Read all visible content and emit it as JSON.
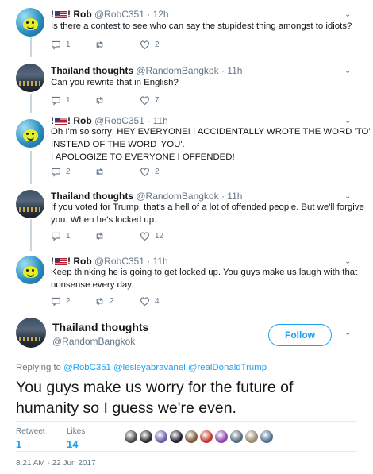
{
  "thread": [
    {
      "name": "! Rob",
      "name_prefix": "!",
      "handle": "@RobC351",
      "time": "12h",
      "text_lines": [
        "Is there a contest to see who can say the stupidest thing amongst to idiots?"
      ],
      "reply_count": "1",
      "retweet_count": "",
      "like_count": "2"
    },
    {
      "name": "Thailand thoughts",
      "handle": "@RandomBangkok",
      "time": "11h",
      "text_lines": [
        "Can you rewrite that in English?"
      ],
      "reply_count": "1",
      "retweet_count": "",
      "like_count": "7"
    },
    {
      "name": "! Rob",
      "name_prefix": "!",
      "handle": "@RobC351",
      "time": "11h",
      "text_lines": [
        "Oh I'm so sorry! HEY EVERYONE! I ACCIDENTALLY WROTE THE WORD 'TO'",
        "INSTEAD OF THE WORD 'YOU'.",
        "I APOLOGIZE TO EVERYONE I OFFENDED!"
      ],
      "reply_count": "2",
      "retweet_count": "",
      "like_count": "2"
    },
    {
      "name": "Thailand thoughts",
      "handle": "@RandomBangkok",
      "time": "11h",
      "text_lines": [
        "If you voted for Trump, that's a hell of a lot of offended people. But we'll forgive",
        "you. When he's locked up."
      ],
      "reply_count": "1",
      "retweet_count": "",
      "like_count": "12"
    },
    {
      "name": "! Rob",
      "name_prefix": "!",
      "handle": "@RobC351",
      "time": "11h",
      "text_lines": [
        "Keep thinking he is going to get locked up. You guys make us laugh with that",
        "nonsense every day."
      ],
      "reply_count": "2",
      "retweet_count": "2",
      "like_count": "4"
    }
  ],
  "main_tweet": {
    "name": "Thailand thoughts",
    "handle": "@RandomBangkok",
    "follow_label": "Follow",
    "replying_prefix": "Replying to",
    "replying_to": "@RobC351 @lesleyabravanel @realDonaldTrump",
    "text_lines": [
      "You guys make us worry for the future of",
      "humanity so I guess we're even."
    ],
    "retweets_label": "Retweet",
    "retweets_count": "1",
    "likes_label": "Likes",
    "likes_count": "14",
    "timestamp": "8:21 AM - 22 Jun 2017"
  },
  "icons": {
    "reply": "reply-icon",
    "retweet": "retweet-icon",
    "like": "heart-icon",
    "more": "chevron-down-icon",
    "flag": "us-flag-icon"
  },
  "colors": {
    "accent": "#1da1f2",
    "muted": "#657786",
    "text": "#14171a",
    "border": "#e6ecf0"
  },
  "liker_colors": [
    "#4a4a4a",
    "#2c2c2c",
    "#6b5fa8",
    "#1e1e2e",
    "#7d5a3b",
    "#c0392b",
    "#8e44ad",
    "#556b7a",
    "#9a8870",
    "#4f6f8f"
  ]
}
